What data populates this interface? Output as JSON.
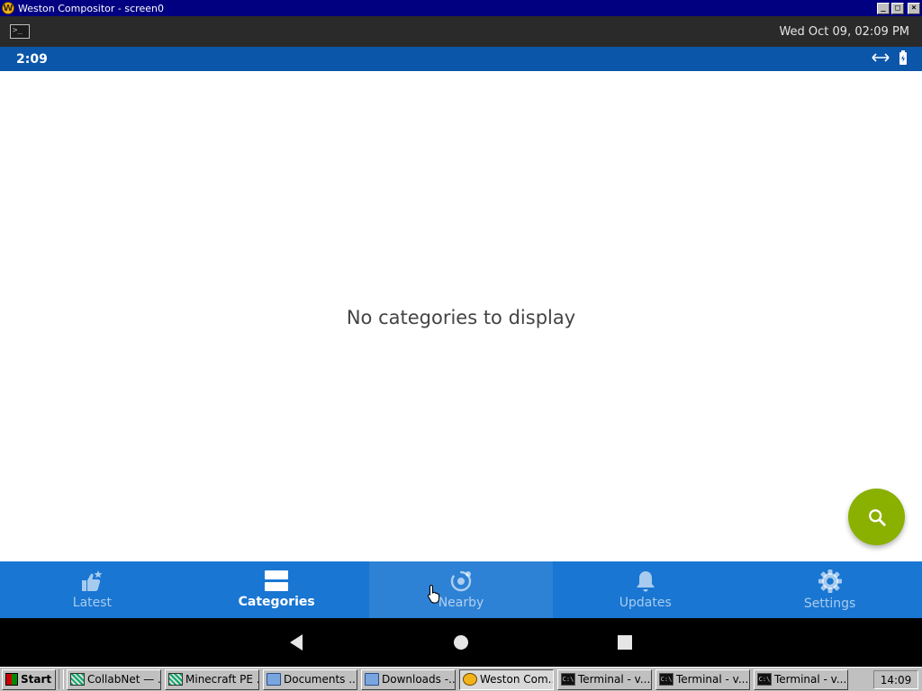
{
  "window": {
    "title": "Weston Compositor - screen0",
    "icon": "weston-icon",
    "buttons": [
      "minimize",
      "maximize",
      "close"
    ]
  },
  "weston_panel": {
    "launcher_icon": "terminal-icon",
    "clock": "Wed Oct 09, 02:09 PM"
  },
  "status_bar": {
    "time": "2:09",
    "icons": [
      "network-arrows-icon",
      "battery-icon"
    ]
  },
  "main": {
    "empty_message": "No categories to display",
    "fab_icon": "search-icon"
  },
  "bottom_nav": {
    "items": [
      {
        "label": "Latest",
        "icon": "latest-icon",
        "active": false
      },
      {
        "label": "Categories",
        "icon": "categories-icon",
        "active": true
      },
      {
        "label": "Nearby",
        "icon": "nearby-icon",
        "active": false
      },
      {
        "label": "Updates",
        "icon": "bell-icon",
        "active": false
      },
      {
        "label": "Settings",
        "icon": "gear-icon",
        "active": false
      }
    ]
  },
  "android_nav": {
    "buttons": [
      "back-icon",
      "home-icon",
      "recents-icon"
    ]
  },
  "taskbar": {
    "start_label": "Start",
    "tasks": [
      {
        "label": "CollabNet — ...",
        "icon": "cross-icon"
      },
      {
        "label": "Minecraft PE ...",
        "icon": "cross-icon"
      },
      {
        "label": "Documents ...",
        "icon": "folder-icon"
      },
      {
        "label": "Downloads -...",
        "icon": "folder-icon"
      },
      {
        "label": "Weston Com...",
        "icon": "weston-icon",
        "active": true
      },
      {
        "label": "Terminal - v...",
        "icon": "terminal-icon"
      },
      {
        "label": "Terminal - v...",
        "icon": "terminal-icon"
      },
      {
        "label": "Terminal - v...",
        "icon": "terminal-icon"
      }
    ],
    "clock": "14:09"
  },
  "colors": {
    "status_bar": "#0b56a8",
    "bottom_nav": "#1976d2",
    "fab": "#8ab000"
  }
}
